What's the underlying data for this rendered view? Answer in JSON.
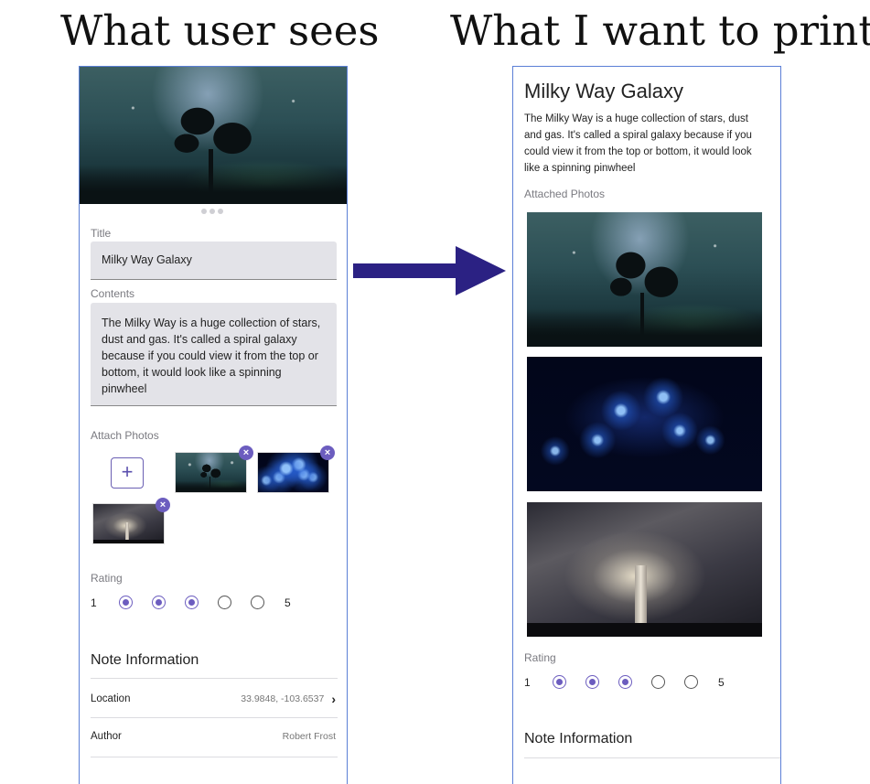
{
  "headings": {
    "left": "What user sees",
    "right": "What I want to print"
  },
  "edit_screen": {
    "title_label": "Title",
    "title_value": "Milky Way Galaxy",
    "contents_label": "Contents",
    "contents_value": "The Milky Way is a huge collection of stars, dust and gas. It's called a spiral galaxy because if you could view it from the top or bottom, it would look like a spinning pinwheel",
    "attach_label": "Attach Photos",
    "add_photo_icon": "+",
    "remove_icon": "×",
    "rating_label": "Rating",
    "rating_min": "1",
    "rating_max": "5",
    "rating_value": 3,
    "note_info_title": "Note Information",
    "location_label": "Location",
    "location_value": "33.9848, -103.6537",
    "chevron": "›",
    "author_label": "Author",
    "author_value": "Robert Frost"
  },
  "print_screen": {
    "title": "Milky Way Galaxy",
    "body": "The Milky Way is a huge collection of stars, dust and gas. It's called a spiral galaxy because if you could view it from the top or bottom, it would look like a spinning pinwheel",
    "attached_label": "Attached Photos",
    "rating_label": "Rating",
    "rating_min": "1",
    "rating_max": "5",
    "rating_value": 3,
    "note_info_title": "Note Information"
  },
  "colors": {
    "accent": "#6c5dbf",
    "arrow": "#2b2183",
    "frame": "#5b7fd6"
  }
}
